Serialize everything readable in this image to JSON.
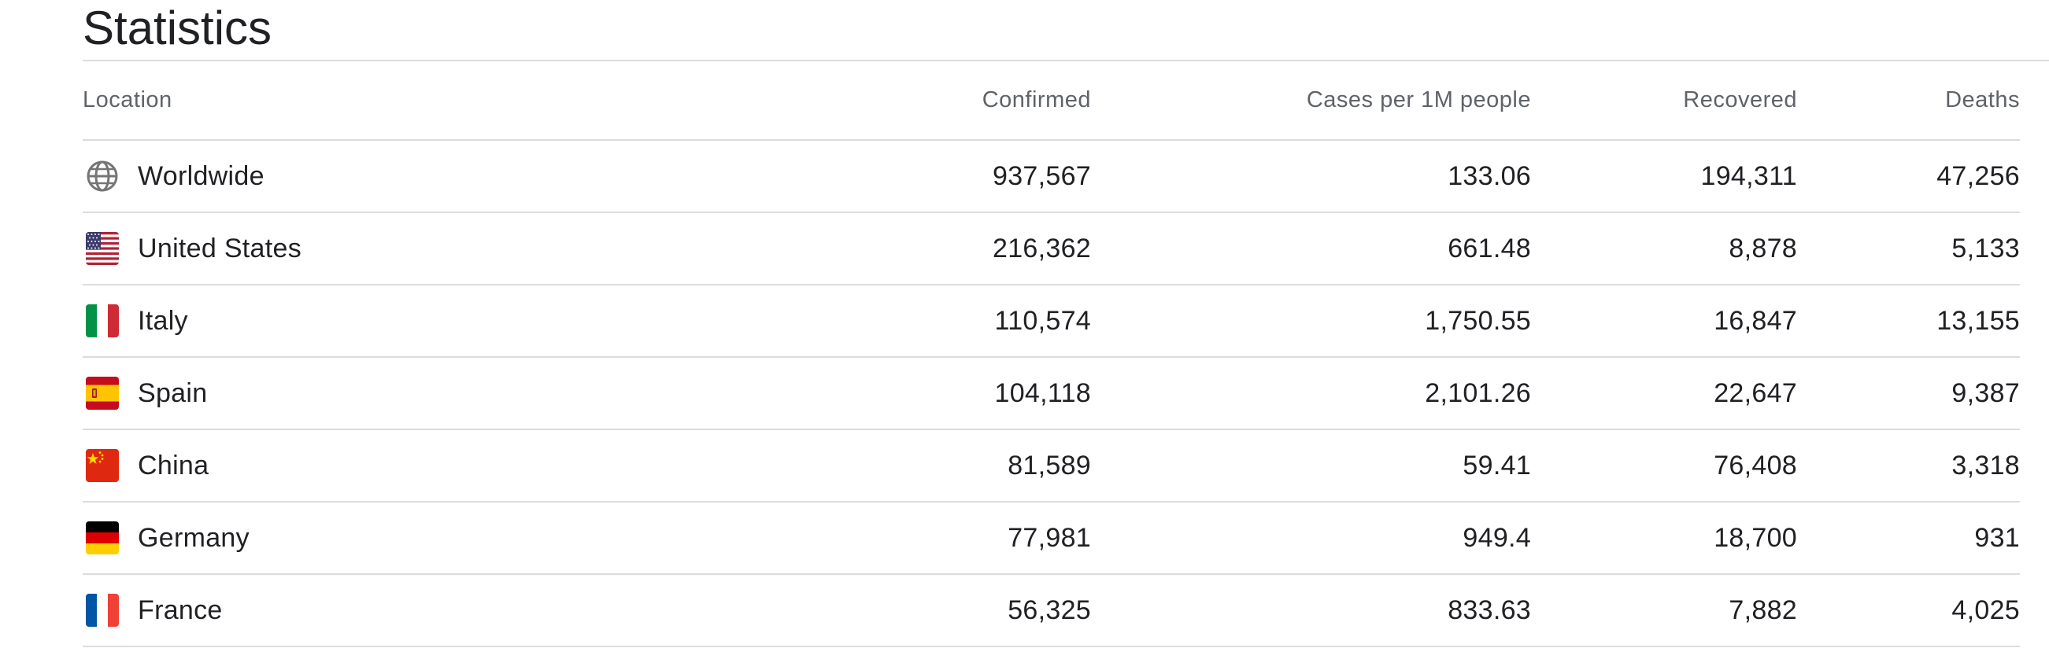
{
  "page": {
    "title": "Statistics"
  },
  "table": {
    "headers": {
      "location": "Location",
      "confirmed": "Confirmed",
      "cases_per_1m": "Cases per 1M people",
      "recovered": "Recovered",
      "deaths": "Deaths"
    },
    "rows": [
      {
        "location": "Worldwide",
        "icon": "globe-icon",
        "confirmed": "937,567",
        "cases_per_1m": "133.06",
        "recovered": "194,311",
        "deaths": "47,256"
      },
      {
        "location": "United States",
        "icon": "us-flag-icon",
        "confirmed": "216,362",
        "cases_per_1m": "661.48",
        "recovered": "8,878",
        "deaths": "5,133"
      },
      {
        "location": "Italy",
        "icon": "italy-flag-icon",
        "confirmed": "110,574",
        "cases_per_1m": "1,750.55",
        "recovered": "16,847",
        "deaths": "13,155"
      },
      {
        "location": "Spain",
        "icon": "spain-flag-icon",
        "confirmed": "104,118",
        "cases_per_1m": "2,101.26",
        "recovered": "22,647",
        "deaths": "9,387"
      },
      {
        "location": "China",
        "icon": "china-flag-icon",
        "confirmed": "81,589",
        "cases_per_1m": "59.41",
        "recovered": "76,408",
        "deaths": "3,318"
      },
      {
        "location": "Germany",
        "icon": "germany-flag-icon",
        "confirmed": "77,981",
        "cases_per_1m": "949.4",
        "recovered": "18,700",
        "deaths": "931"
      },
      {
        "location": "France",
        "icon": "france-flag-icon",
        "confirmed": "56,325",
        "cases_per_1m": "833.63",
        "recovered": "7,882",
        "deaths": "4,025"
      }
    ]
  },
  "colors": {
    "text": "#202124",
    "header_text": "#5f6368",
    "divider": "#dadce0"
  }
}
